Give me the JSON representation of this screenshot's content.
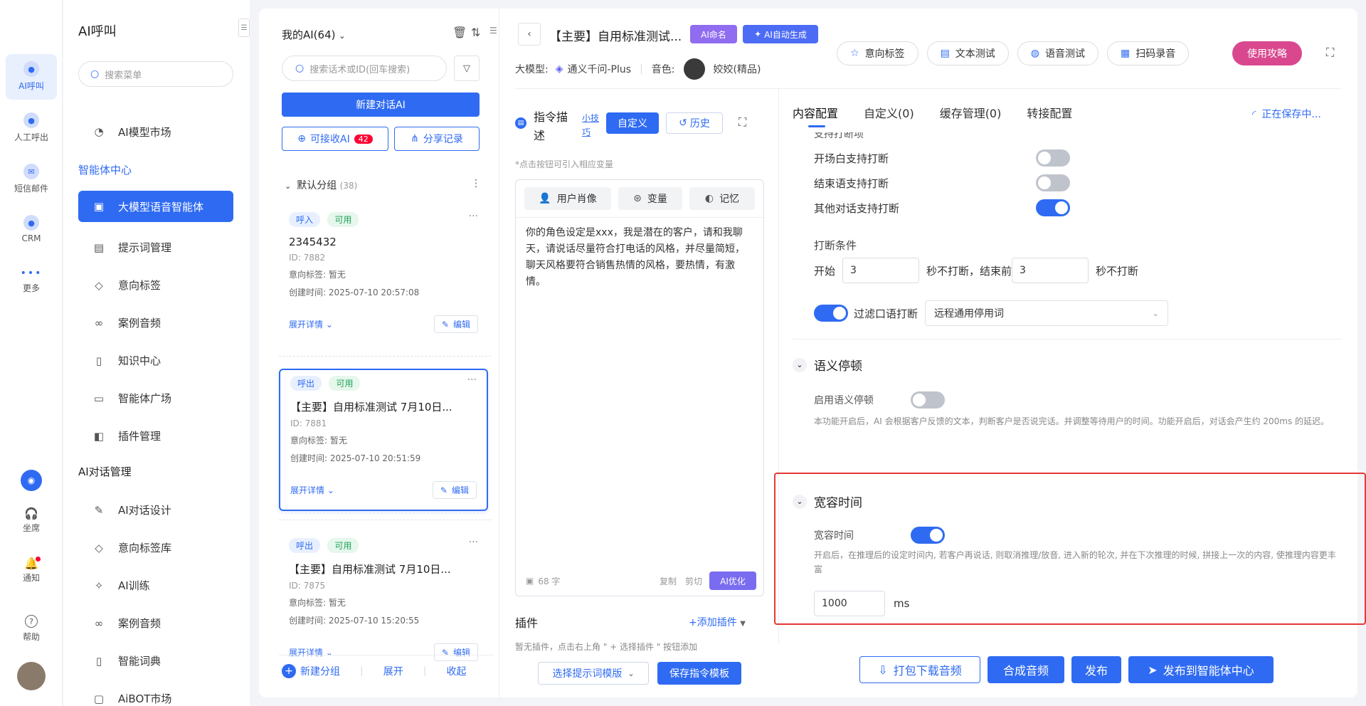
{
  "rail": {
    "items": [
      {
        "label": "AI呼叫",
        "icon": "ai-call-icon"
      },
      {
        "label": "人工呼出",
        "icon": "manual-call-icon"
      },
      {
        "label": "短信邮件",
        "icon": "sms-mail-icon"
      },
      {
        "label": "CRM",
        "icon": "crm-icon"
      },
      {
        "label": "更多",
        "icon": "more-dots-icon"
      }
    ],
    "bottom": [
      {
        "label": "坐席",
        "icon": "headset-icon"
      },
      {
        "label": "通知",
        "icon": "bell-icon"
      },
      {
        "label": "帮助",
        "icon": "help-icon"
      }
    ]
  },
  "sidebar": {
    "title": "AI呼叫",
    "search_placeholder": "搜索菜单",
    "top_item": "AI模型市场",
    "group1": "智能体中心",
    "items1": [
      "大模型语音智能体",
      "提示词管理",
      "意向标签",
      "案例音频",
      "知识中心",
      "智能体广场",
      "插件管理"
    ],
    "group2": "AI对话管理",
    "items2": [
      "AI对话设计",
      "意向标签库",
      "AI训练",
      "案例音频",
      "智能词典",
      "AiBOT市场"
    ]
  },
  "list": {
    "title": "我的AI(64)",
    "search_placeholder": "搜索话术或ID(回车搜索)",
    "new_button": "新建对话AI",
    "receive_label": "可接收AI",
    "receive_count": "42",
    "share_label": "分享记录",
    "group_name": "默认分组",
    "group_count": "(38)",
    "cards": [
      {
        "dir": "呼入",
        "status": "可用",
        "name": "2345432",
        "id": "ID: 7882",
        "intent": "意向标签:  暂无",
        "created": "创建时间:  2025-07-10 20:57:08",
        "expand": "展开详情",
        "edit": "编辑"
      },
      {
        "dir": "呼出",
        "status": "可用",
        "name": "【主要】自用标准测试 7月10日...",
        "id": "ID: 7881",
        "intent": "意向标签:  暂无",
        "created": "创建时间:  2025-07-10 20:51:59",
        "expand": "展开详情",
        "edit": "编辑"
      },
      {
        "dir": "呼出",
        "status": "可用",
        "name": "【主要】自用标准测试 7月10日...",
        "id": "ID: 7875",
        "intent": "意向标签:  暂无",
        "created": "创建时间:  2025-07-10 15:20:55",
        "expand": "展开详情",
        "edit": "编辑"
      }
    ],
    "footer": {
      "new_group": "新建分组",
      "expand": "展开",
      "collapse": "收起"
    }
  },
  "header": {
    "title": "【主要】自用标准测试...",
    "ai_name_btn": "AI命名",
    "ai_auto_btn": "AI自动生成",
    "model_label": "大模型:",
    "model_value": "通义千问-Plus",
    "voice_label": "音色:",
    "voice_value": "姣姣(精品)",
    "actions": [
      "意向标签",
      "文本测试",
      "语音测试",
      "扫码录音"
    ],
    "guide_btn": "使用攻略"
  },
  "prompt": {
    "title": "指令描述",
    "tips_link": "小技巧",
    "custom_btn": "自定义",
    "history_btn": "历史",
    "hint": "*点击按钮可引入相应变量",
    "chips": [
      "用户肖像",
      "变量",
      "记忆"
    ],
    "text": "你的角色设定是xxx，我是潜在的客户，请和我聊天，请说话尽量符合打电话的风格，并尽量简短，聊天风格要符合销售热情的风格，要热情，有激情。",
    "char_count": "68 字",
    "copy": "复制",
    "cut": "剪切",
    "optimize_btn": "AI优化",
    "plugin_title": "插件",
    "add_plugin": "添加插件",
    "plugin_empty": "暂无插件，点击右上角 \" + 选择插件 \" 按钮添加",
    "select_template_btn": "选择提示词模版",
    "save_template_btn": "保存指令模板"
  },
  "config": {
    "tabs": [
      "内容配置",
      "自定义(0)",
      "缓存管理(0)",
      "转接配置"
    ],
    "saving": "正在保存中...",
    "cut_heading": "支持打断项",
    "interrupt_rows": [
      {
        "label": "开场白支持打断",
        "on": false
      },
      {
        "label": "结束语支持打断",
        "on": false
      },
      {
        "label": "其他对话支持打断",
        "on": true
      }
    ],
    "cond_label": "打断条件",
    "start_label": "开始",
    "start_value": "3",
    "mid_label": "秒不打断，结束前",
    "end_value": "3",
    "end_label": "秒不打断",
    "filter_label": "过滤口语打断",
    "filter_select": "远程通用停用词",
    "semantic": {
      "title": "语义停顿",
      "toggle_label": "启用语义停顿",
      "on": false,
      "desc": "本功能开启后，AI 会根据客户反馈的文本，判断客户是否说完话。并调整等待用户的时间。功能开启后，对话会产生约 200ms 的延迟。"
    },
    "grace": {
      "title": "宽容时间",
      "toggle_label": "宽容时间",
      "on": true,
      "desc": "开启后，在推理后的设定时间内, 若客户再说话, 则取消推理/放音, 进入新的轮次, 并在下次推理的时候, 拼接上一次的内容, 使推理内容更丰富",
      "value": "1000",
      "unit": "ms"
    }
  },
  "footer_actions": [
    "打包下载音频",
    "合成音频",
    "发布",
    "发布到智能体中心"
  ],
  "colors": {
    "primary": "#2f6bf2",
    "highlight_border": "#e53935",
    "purple": "#8f6cf0",
    "guide_pink": "#d9488f"
  }
}
